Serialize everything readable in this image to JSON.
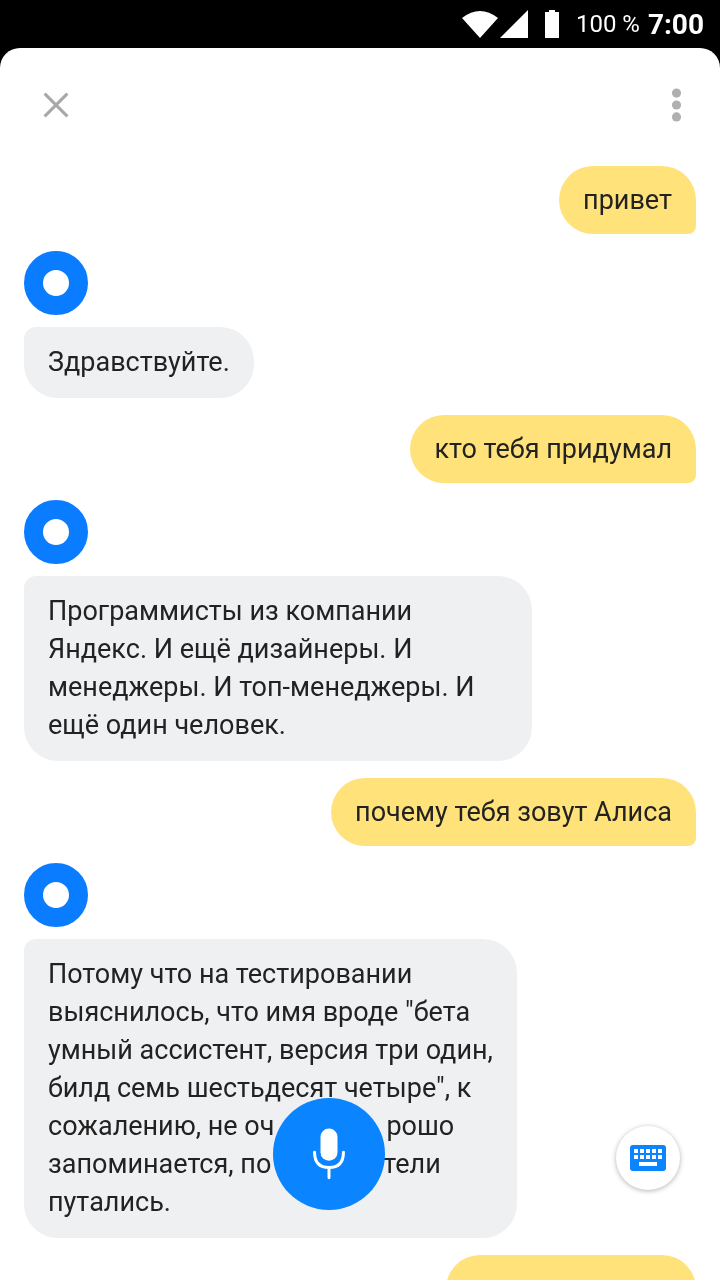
{
  "status_bar": {
    "battery": "100 %",
    "time": "7:00"
  },
  "messages": [
    {
      "kind": "user",
      "text": "привет"
    },
    {
      "kind": "bot",
      "text": "Здравствуйте."
    },
    {
      "kind": "user",
      "text": "кто тебя придумал"
    },
    {
      "kind": "bot",
      "text": "Программисты из компании Яндекс. И ещё дизайнеры. И менеджеры. И топ-менеджеры. И ещё один человек."
    },
    {
      "kind": "user",
      "text": "почему тебя зовут Алиса"
    },
    {
      "kind": "bot",
      "lines": [
        [
          "Потому что на тестировании"
        ],
        [
          "выяснилось, что имя вроде \"бета"
        ],
        [
          "умный ассистент, версия три один,"
        ],
        [
          "билд семь шестьдесят четыре\", к"
        ],
        [
          "сожалению, не оч",
          "рошо"
        ],
        [
          "запоминается, по",
          "тели"
        ],
        [
          "путались."
        ]
      ]
    },
    {
      "kind": "user_cut"
    }
  ]
}
